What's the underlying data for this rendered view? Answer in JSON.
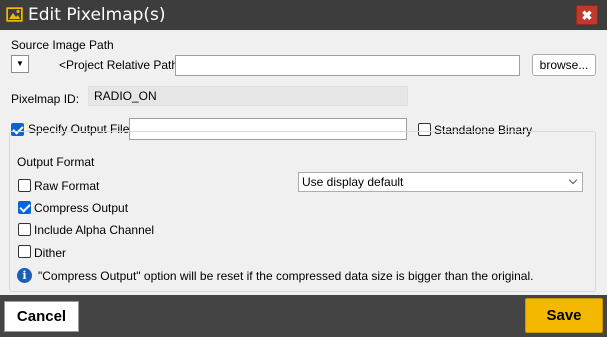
{
  "window": {
    "title": "Edit Pixelmap(s)",
    "icon": "image-icon",
    "close_glyph": "✖"
  },
  "source": {
    "label": "Source Image Path",
    "path_mode": "<Project Relative Path>",
    "path_value": "",
    "dropdown_glyph": "▼",
    "browse_label": "browse..."
  },
  "pixelmap": {
    "label": "Pixelmap ID:",
    "value": "RADIO_ON"
  },
  "output_file": {
    "label": "Specify Output File",
    "checked": true,
    "value": "",
    "standalone_label": "Standalone Binary",
    "standalone_checked": false
  },
  "output_format": {
    "title": "Output Format",
    "raw_format": {
      "label": "Raw Format",
      "checked": false
    },
    "compress_output": {
      "label": "Compress Output",
      "checked": true
    },
    "alpha_channel": {
      "label": "Include Alpha Channel",
      "checked": false
    },
    "dither": {
      "label": "Dither",
      "checked": false
    },
    "format_select": "Use display default",
    "info_glyph": "i",
    "info_text": "\"Compress Output\" option will be reset if the compressed data size is bigger than the original."
  },
  "footer": {
    "cancel_label": "Cancel",
    "save_label": "Save",
    "save_color": "#f5b800"
  }
}
